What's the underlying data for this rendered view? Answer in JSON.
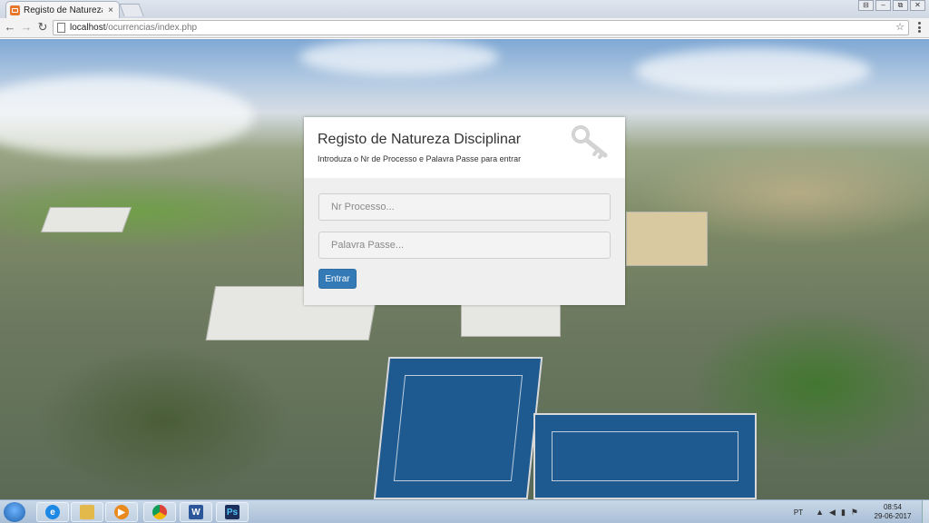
{
  "browser": {
    "tab_title": "Registo de Natureza Disc",
    "tab_close": "×",
    "url_host": "localhost",
    "url_path": "/ocurrencias/index.php",
    "window_controls": [
      "⊟",
      "–",
      "⧉",
      "✕"
    ]
  },
  "login": {
    "title": "Registo de Natureza Disciplinar",
    "subtitle": "Introduza o Nr de Processo e Palavra Passe para entrar",
    "process_placeholder": "Nr Processo...",
    "password_placeholder": "Palavra Passe...",
    "submit_label": "Entrar"
  },
  "taskbar": {
    "apps": [
      {
        "name": "internet-explorer",
        "glyph": "e",
        "color": "#1e88e5"
      },
      {
        "name": "file-explorer",
        "glyph": "",
        "color": "#e2b94a"
      },
      {
        "name": "media-player",
        "glyph": "▶",
        "color": "#e98a1f"
      },
      {
        "name": "chrome",
        "glyph": "",
        "color": "#db4437"
      },
      {
        "name": "word",
        "glyph": "W",
        "color": "#2b579a"
      },
      {
        "name": "photoshop",
        "glyph": "Ps",
        "color": "#1c2f5a"
      }
    ],
    "language": "PT",
    "time": "08:54",
    "date": "29-06-2017"
  },
  "colors": {
    "primary_button": "#337ab7",
    "card_background": "#efefef"
  }
}
